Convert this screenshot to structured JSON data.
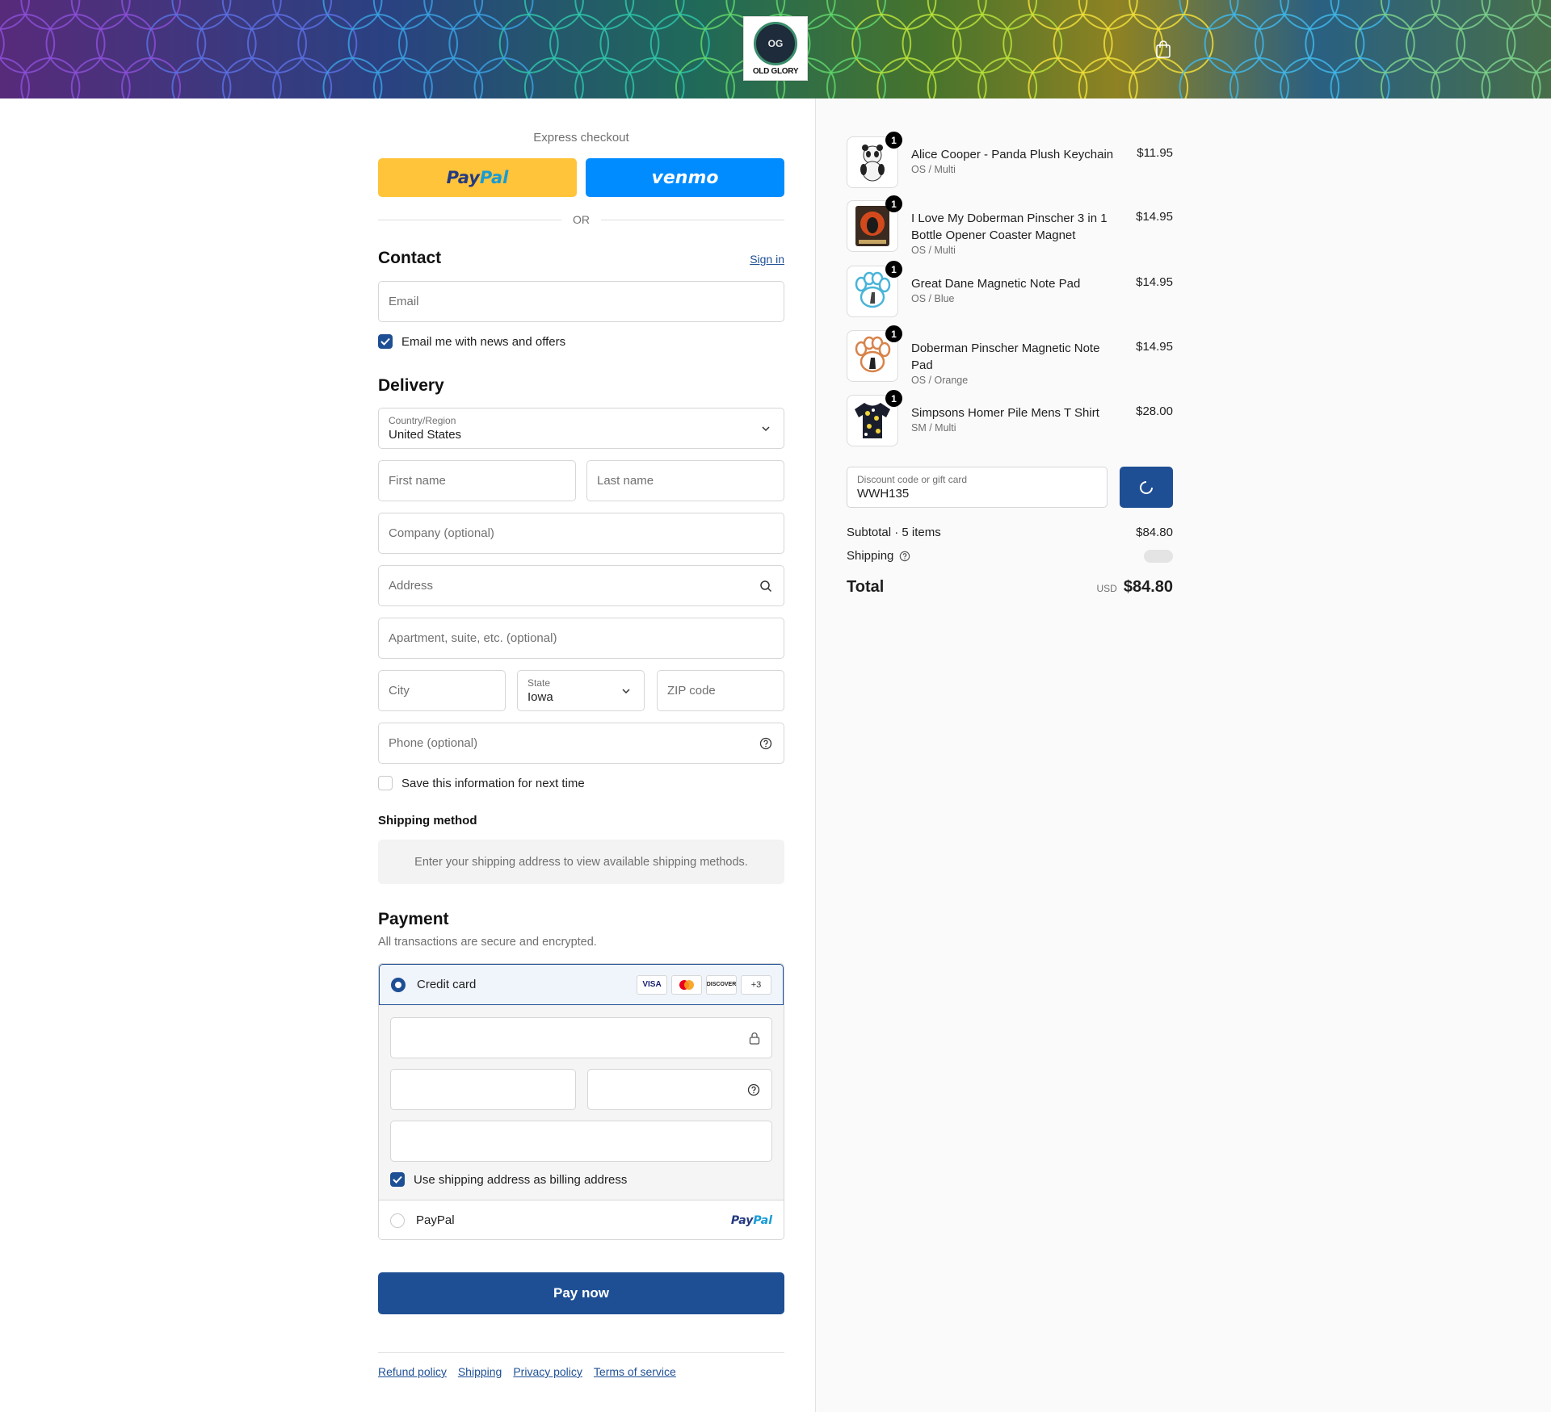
{
  "header": {
    "logo_initials": "OG",
    "logo_name": "OLD GLORY",
    "cart_icon": "shopping-bag-icon"
  },
  "express": {
    "title": "Express checkout",
    "paypal_a": "Pay",
    "paypal_b": "Pal",
    "venmo": "venmo",
    "or": "OR"
  },
  "contact": {
    "title": "Contact",
    "sign_in": "Sign in",
    "email_placeholder": "Email",
    "news_label": "Email me with news and offers",
    "news_checked": true
  },
  "delivery": {
    "title": "Delivery",
    "country_label": "Country/Region",
    "country_value": "United States",
    "first_name": "First name",
    "last_name": "Last name",
    "company": "Company (optional)",
    "address": "Address",
    "apartment": "Apartment, suite, etc. (optional)",
    "city": "City",
    "state_label": "State",
    "state_value": "Iowa",
    "zip": "ZIP code",
    "phone": "Phone (optional)",
    "save_label": "Save this information for next time",
    "save_checked": false
  },
  "shipping_method": {
    "title": "Shipping method",
    "notice": "Enter your shipping address to view available shipping methods."
  },
  "payment": {
    "title": "Payment",
    "subtitle": "All transactions are secure and encrypted.",
    "credit_card": "Credit card",
    "card_brands": [
      "VISA",
      "",
      "DISCOVER",
      "+3"
    ],
    "billing_label": "Use shipping address as billing address",
    "billing_checked": true,
    "paypal_option": "PayPal",
    "paypal_logo_a": "Pay",
    "paypal_logo_b": "Pal"
  },
  "pay_now": "Pay now",
  "footer": [
    "Refund policy",
    "Shipping",
    "Privacy policy",
    "Terms of service"
  ],
  "items": [
    {
      "name": "Alice Cooper - Panda Plush Keychain",
      "variant": "OS / Multi",
      "price": "$11.95",
      "qty": "1"
    },
    {
      "name": "I Love My Doberman Pinscher 3 in 1 Bottle Opener Coaster Magnet",
      "variant": "OS / Multi",
      "price": "$14.95",
      "qty": "1"
    },
    {
      "name": "Great Dane Magnetic Note Pad",
      "variant": "OS / Blue",
      "price": "$14.95",
      "qty": "1"
    },
    {
      "name": "Doberman Pinscher Magnetic Note Pad",
      "variant": "OS / Orange",
      "price": "$14.95",
      "qty": "1"
    },
    {
      "name": "Simpsons Homer Pile Mens T Shirt",
      "variant": "SM / Multi",
      "price": "$28.00",
      "qty": "1"
    }
  ],
  "discount": {
    "label": "Discount code or gift card",
    "value": "WWH135"
  },
  "summary": {
    "subtotal_label": "Subtotal · 5 items",
    "subtotal_value": "$84.80",
    "shipping_label": "Shipping",
    "total_label": "Total",
    "currency": "USD",
    "total_value": "$84.80"
  },
  "colors": {
    "accent": "#1e4f94",
    "paypal_yellow": "#ffc439",
    "venmo_blue": "#008cff"
  }
}
